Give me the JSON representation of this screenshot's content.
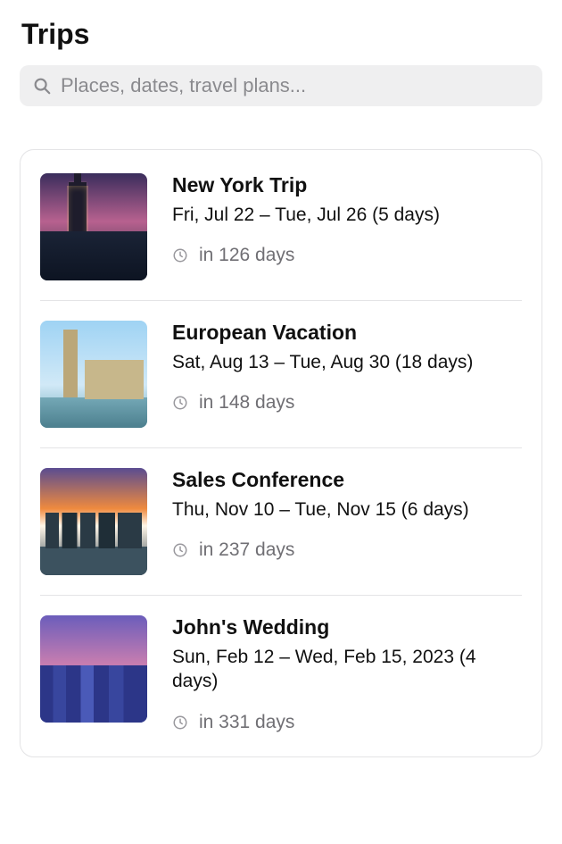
{
  "header": {
    "title": "Trips"
  },
  "search": {
    "placeholder": "Places, dates, travel plans..."
  },
  "trips": [
    {
      "title": "New York Trip",
      "dates": "Fri, Jul 22 – Tue, Jul 26 (5 days)",
      "countdown": "in 126 days"
    },
    {
      "title": "European Vacation",
      "dates": "Sat, Aug 13 – Tue, Aug 30 (18 days)",
      "countdown": "in 148 days"
    },
    {
      "title": "Sales Conference",
      "dates": "Thu, Nov 10 – Tue, Nov 15 (6 days)",
      "countdown": "in 237 days"
    },
    {
      "title": "John's Wedding",
      "dates": "Sun, Feb 12 – Wed, Feb 15, 2023 (4 days)",
      "countdown": "in 331 days"
    }
  ]
}
